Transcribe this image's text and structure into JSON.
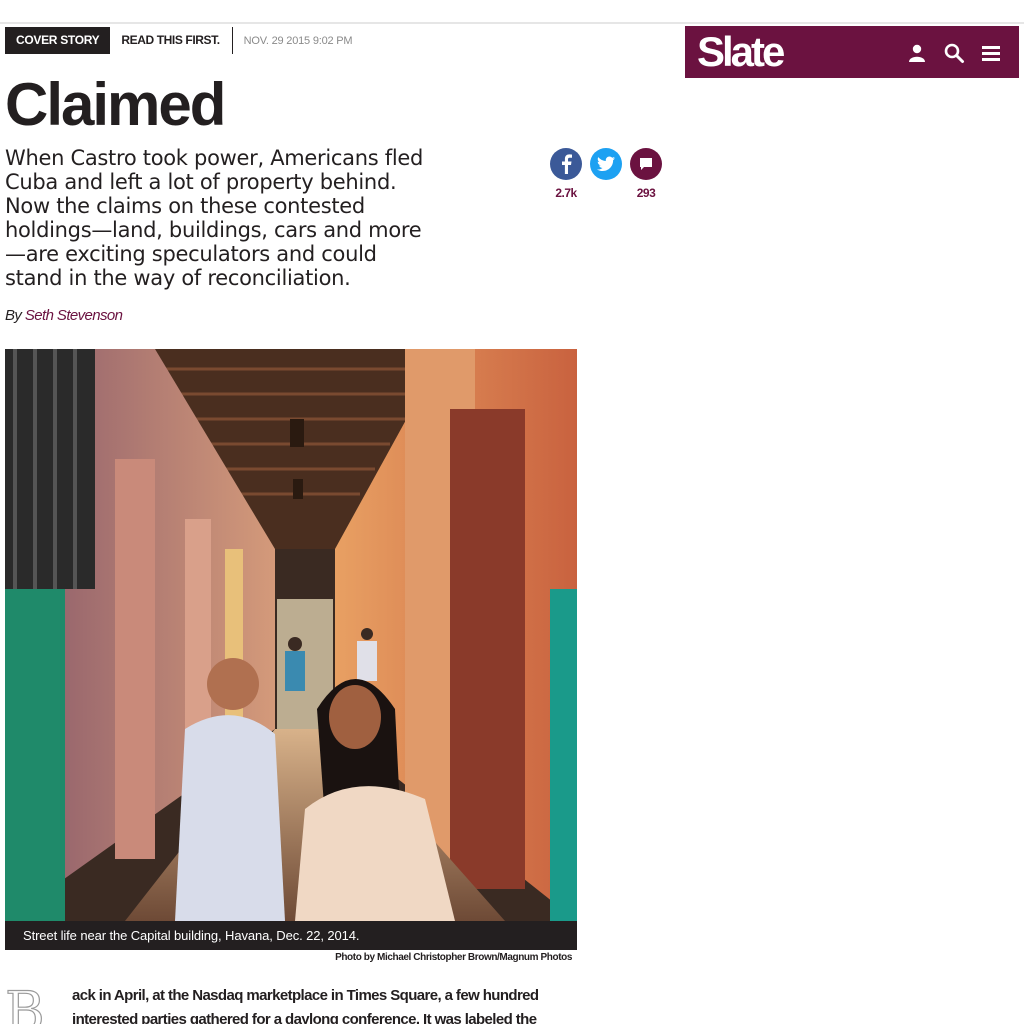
{
  "section": {
    "label": "COVER STORY",
    "tagline": "READ THIS FIRST.",
    "date": "NOV. 29 2015 9:02 PM"
  },
  "header": {
    "logo": "Slate",
    "icons": [
      "user-icon",
      "search-icon",
      "menu-icon"
    ],
    "background": "#6b1240"
  },
  "article": {
    "title": "Claimed",
    "dek": "When Castro took power, Americans fled Cuba and left a lot of property behind. Now the claims on these contested holdings—land, buildings, cars and more—are exciting speculators and could stand in the way of reconciliation.",
    "byline_prefix": "By",
    "author": "Seth Stevenson",
    "photo_caption": "Street life near the Capital building, Havana, Dec. 22, 2014.",
    "photo_credit": "Photo by Michael Christopher Brown/Magnum Photos",
    "dropcap": "B",
    "body_start": "ack in April, at the Nasdaq marketplace in Times Square, a few hundred interested parties gathered for a daylong conference. It was labeled the “Cuba Opportunity"
  },
  "share": {
    "facebook_count": "2.7k",
    "comment_count": "293",
    "colors": {
      "facebook": "#3b5998",
      "twitter": "#1da1f2",
      "comments": "#6b1240"
    }
  }
}
